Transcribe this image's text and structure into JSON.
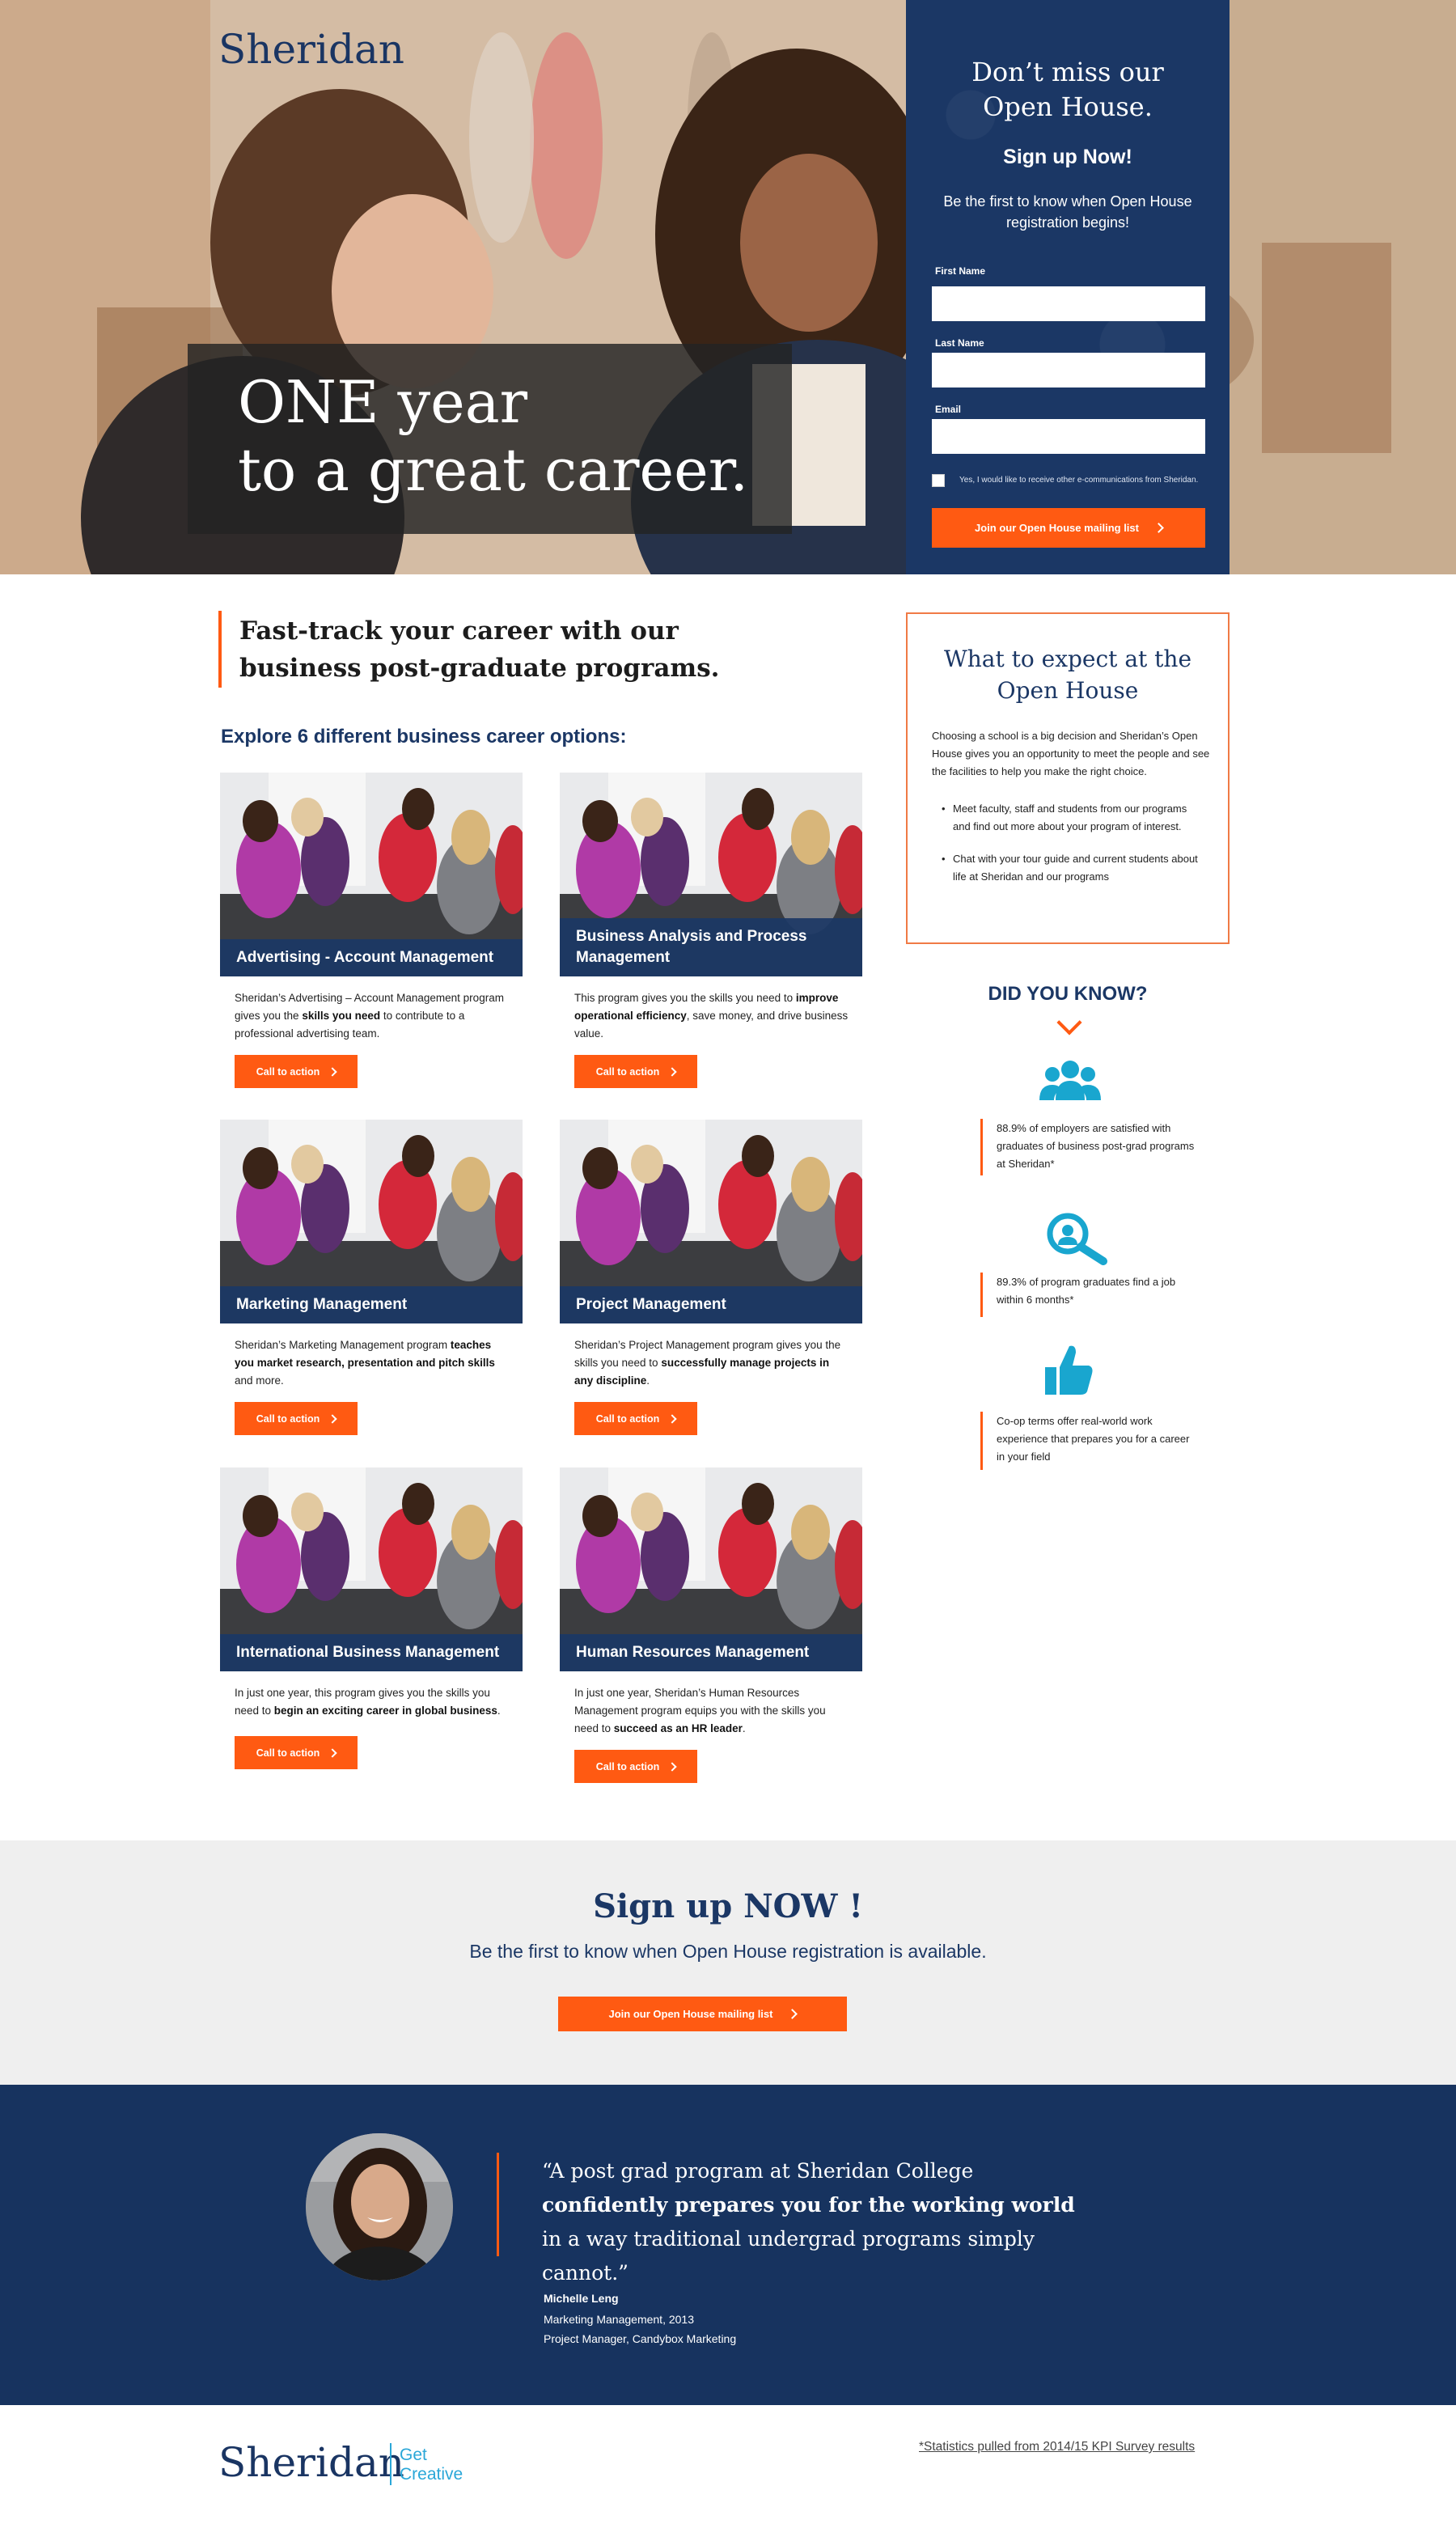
{
  "hero": {
    "logo": "Sheridan",
    "tagline_line1": "ONE year",
    "tagline_line2": "to a great career."
  },
  "signup_form": {
    "title_line1": "Don’t miss our",
    "title_line2": "Open House.",
    "subtitle": "Sign up Now!",
    "description": "Be the first to know when Open House registration begins!",
    "first_name_label": "First Name",
    "last_name_label": "Last Name",
    "email_label": "Email",
    "first_name_value": "",
    "last_name_value": "",
    "email_value": "",
    "checkbox_label": "Yes, I would like to receive other e-communications from Sheridan.",
    "checkbox_checked": false,
    "submit_label": "Join our Open House mailing list"
  },
  "intro": {
    "headline": "Fast-track your career with our business post-graduate programs.",
    "explore_heading": "Explore 6 different business career options:"
  },
  "programs": [
    {
      "title": "Advertising - Account Management",
      "desc_before": "Sheridan’s Advertising – Account Management program gives you the ",
      "desc_bold": "skills you need",
      "desc_after": " to contribute to a professional advertising team.",
      "cta": "Call to action"
    },
    {
      "title": "Business Analysis and Process Management",
      "desc_before": "This program gives you the skills you need to ",
      "desc_bold": "improve operational efficiency",
      "desc_after": ", save money, and drive business value.",
      "cta": "Call to action"
    },
    {
      "title": "Marketing Management",
      "desc_before": "Sheridan’s Marketing Management program ",
      "desc_bold": "teaches you market research, presentation and pitch skills",
      "desc_after": " and more.",
      "cta": "Call to action"
    },
    {
      "title": "Project Management",
      "desc_before": "Sheridan’s Project Management program gives you the skills you need to ",
      "desc_bold": "successfully manage projects in any discipline",
      "desc_after": ".",
      "cta": "Call to action"
    },
    {
      "title": "International Business Management",
      "desc_before": "In just one year, this program gives you the skills you need to ",
      "desc_bold": "begin an exciting career in global business",
      "desc_after": ".",
      "cta": "Call to action"
    },
    {
      "title": "Human Resources Management",
      "desc_before": "In just one year, Sheridan’s Human Resources Management program equips you with the skills you need to ",
      "desc_bold": "succeed as an HR leader",
      "desc_after": ".",
      "cta": "Call to action"
    }
  ],
  "expect": {
    "title_line1": "What to expect at the",
    "title_line2": "Open House",
    "description": "Choosing a school is a big decision and Sheridan’s Open House gives you an opportunity to meet the people and see the facilities to help you make the right choice.",
    "bullets": [
      "Meet faculty, staff and students from our programs and find out more about your program of interest.",
      "Chat with your tour guide and current students about life at Sheridan and our programs"
    ]
  },
  "did_you_know": {
    "heading": "DID YOU KNOW?",
    "stats": [
      {
        "icon": "group-icon",
        "text": "88.9% of employers are satisfied with graduates of business post-grad programs at Sheridan*"
      },
      {
        "icon": "magnifier-icon",
        "text": "89.3% of program graduates find a job within 6 months*"
      },
      {
        "icon": "thumbs-up-icon",
        "text": "Co-op terms offer real-world work experience that prepares you for a career in your field"
      }
    ]
  },
  "signup_band": {
    "title": "Sign up NOW !",
    "subtitle": "Be the first to know when Open House registration is available.",
    "button": "Join our Open House mailing list"
  },
  "testimonial": {
    "quote_open": "“A post grad program at Sheridan College ",
    "quote_bold": "confidently prepares you for the working world",
    "quote_close": " in a way traditional undergrad programs simply cannot.”",
    "name": "Michelle  Leng",
    "program": "Marketing Management, 2013",
    "role": "Project Manager, Candybox Marketing"
  },
  "footer": {
    "logo": "Sheridan",
    "get": "Get",
    "creative": "Creative",
    "note": "*Statistics pulled from 2014/15 KPI Survey results"
  },
  "colors": {
    "navy": "#1b3765",
    "orange": "#ff5a12",
    "cyan": "#2aa7d8",
    "light_gray": "#efefef"
  }
}
